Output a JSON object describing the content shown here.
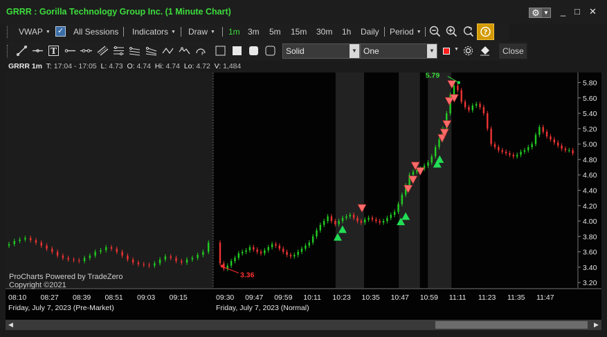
{
  "window": {
    "title": "GRRR : Gorilla Technology Group Inc. (1 Minute Chart)",
    "gear_icon": "gear-icon",
    "min_label": "_",
    "max_label": "□",
    "close_label": "✕"
  },
  "toolbar1": {
    "vwap": "VWAP",
    "all_sessions_checked": true,
    "all_sessions": "All Sessions",
    "indicators": "Indicators",
    "draw": "Draw",
    "intervals": [
      "1m",
      "3m",
      "5m",
      "15m",
      "30m",
      "1h",
      "Daily"
    ],
    "active_interval": "1m",
    "period": "Period"
  },
  "toolbar2": {
    "line_style": "Solid",
    "line_width": "One",
    "line_color": "#ff1e1e",
    "close": "Close"
  },
  "info": {
    "symbol": "GRRR 1m",
    "t_label": "T:",
    "t_value": "17:04 - 17:05",
    "l_label": "L:",
    "l_value": "4.73",
    "o_label": "O:",
    "o_value": "4.74",
    "hi_label": "Hi:",
    "hi_value": "4.74",
    "lo_label": "Lo:",
    "lo_value": "4.72",
    "v_label": "V:",
    "v_value": "1,484"
  },
  "chart_data": {
    "type": "candlestick",
    "y_ticks": [
      "5.80",
      "5.60",
      "5.40",
      "5.20",
      "5.00",
      "4.80",
      "4.60",
      "4.40",
      "4.20",
      "4.00",
      "3.80",
      "3.60",
      "3.40",
      "3.20"
    ],
    "y_range": [
      3.13,
      5.93
    ],
    "x_ticks": [
      "08:10",
      "08:27",
      "08:39",
      "08:51",
      "09:03",
      "09:15",
      "09:30",
      "09:47",
      "09:59",
      "10:11",
      "10:23",
      "10:35",
      "10:47",
      "10:59",
      "11:11",
      "11:23",
      "11:35",
      "11:47"
    ],
    "session_labels": [
      "Friday, July 7, 2023 (Pre-Market)",
      "Friday, July 7, 2023 (Normal)"
    ],
    "high_label": "5.79",
    "low_label": "3.36",
    "watermark": "ProCharts Powered by TradeZero",
    "copyright": "Copyright ©2021",
    "up_color": "#22cc22",
    "down_color": "#ee3333",
    "buy_marker_color": "#22dd55",
    "sell_marker_color": "#ff6a6a",
    "close_prices": [
      3.7,
      3.74,
      3.76,
      3.78,
      3.75,
      3.72,
      3.68,
      3.64,
      3.6,
      3.55,
      3.52,
      3.5,
      3.49,
      3.48,
      3.52,
      3.55,
      3.6,
      3.62,
      3.66,
      3.64,
      3.6,
      3.55,
      3.5,
      3.46,
      3.44,
      3.43,
      3.42,
      3.45,
      3.5,
      3.54,
      3.52,
      3.48,
      3.46,
      3.5,
      3.52,
      3.56,
      3.6,
      3.72,
      3.45,
      3.38,
      3.42,
      3.48,
      3.52,
      3.58,
      3.6,
      3.62,
      3.66,
      3.63,
      3.6,
      3.58,
      3.62,
      3.66,
      3.7,
      3.68,
      3.64,
      3.6,
      3.56,
      3.54,
      3.56,
      3.6,
      3.64,
      3.68,
      3.72,
      3.8,
      3.88,
      3.95,
      4.0,
      4.06,
      4.0,
      3.96,
      4.0,
      4.04,
      4.06,
      4.08,
      4.04,
      4.0,
      3.98,
      4.02,
      4.04,
      4.02,
      4.0,
      3.98,
      4.0,
      4.04,
      4.08,
      4.12,
      4.22,
      4.34,
      4.46,
      4.6,
      4.64,
      4.66,
      4.68,
      4.72,
      4.76,
      4.84,
      4.96,
      5.06,
      5.2,
      5.4,
      5.64,
      5.76,
      5.7,
      5.55,
      5.48,
      5.44,
      5.5,
      5.52,
      5.48,
      5.4,
      5.2,
      5.0,
      4.96,
      4.92,
      4.9,
      4.88,
      4.86,
      4.84,
      4.86,
      4.9,
      4.92,
      4.96,
      5.0,
      5.12,
      5.22,
      5.16,
      5.1,
      5.06,
      5.02,
      4.98,
      4.94,
      4.92,
      4.92,
      4.88
    ],
    "buy_markers": [
      {
        "x": "10:19",
        "y": 3.79
      },
      {
        "x": "10:21",
        "y": 3.89
      },
      {
        "x": "10:45",
        "y": 3.99
      },
      {
        "x": "10:47",
        "y": 4.06
      },
      {
        "x": "11:00",
        "y": 4.74
      },
      {
        "x": "11:01",
        "y": 4.8
      }
    ],
    "sell_markers": [
      {
        "x": "10:29",
        "y": 4.17
      },
      {
        "x": "10:48",
        "y": 4.42
      },
      {
        "x": "10:50",
        "y": 4.54
      },
      {
        "x": "10:51",
        "y": 4.72
      },
      {
        "x": "10:53",
        "y": 4.65
      },
      {
        "x": "11:02",
        "y": 5.08
      },
      {
        "x": "11:03",
        "y": 5.15
      },
      {
        "x": "11:04",
        "y": 5.26
      },
      {
        "x": "11:05",
        "y": 5.56
      },
      {
        "x": "11:06",
        "y": 5.78
      },
      {
        "x": "11:07",
        "y": 5.6
      }
    ],
    "shaded_bands": [
      [
        "10:19",
        "10:29"
      ],
      [
        "10:45",
        "10:52"
      ],
      [
        "10:57",
        "11:05"
      ]
    ]
  }
}
